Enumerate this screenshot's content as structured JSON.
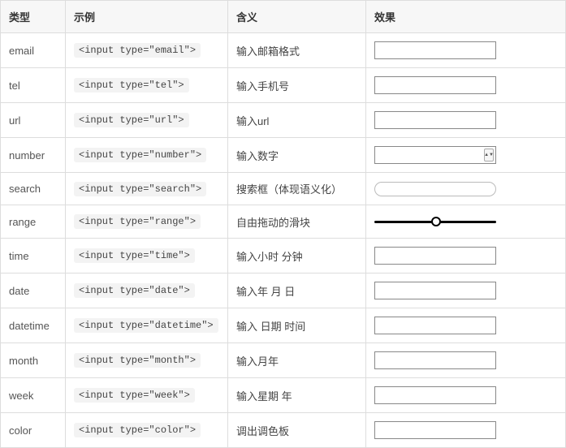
{
  "headers": {
    "type": "类型",
    "example": "示例",
    "meaning": "含义",
    "effect": "效果"
  },
  "rows": [
    {
      "type": "email",
      "example": "<input type=\"email\">",
      "meaning": "输入邮箱格式",
      "effect": "plain"
    },
    {
      "type": "tel",
      "example": "<input type=\"tel\">",
      "meaning": "输入手机号",
      "effect": "plain"
    },
    {
      "type": "url",
      "example": "<input type=\"url\">",
      "meaning": "输入url",
      "effect": "plain"
    },
    {
      "type": "number",
      "example": "<input type=\"number\">",
      "meaning": "输入数字",
      "effect": "number"
    },
    {
      "type": "search",
      "example": "<input type=\"search\">",
      "meaning": "搜索框（体现语义化）",
      "effect": "search"
    },
    {
      "type": "range",
      "example": "<input type=\"range\">",
      "meaning": "自由拖动的滑块",
      "effect": "range"
    },
    {
      "type": "time",
      "example": "<input type=\"time\">",
      "meaning": "输入小时 分钟",
      "effect": "plain"
    },
    {
      "type": "date",
      "example": "<input type=\"date\">",
      "meaning": "输入年 月 日",
      "effect": "plain"
    },
    {
      "type": "datetime",
      "example": "<input type=\"datetime\">",
      "meaning": "输入 日期 时间",
      "effect": "plain"
    },
    {
      "type": "month",
      "example": "<input type=\"month\">",
      "meaning": "输入月年",
      "effect": "plain"
    },
    {
      "type": "week",
      "example": "<input type=\"week\">",
      "meaning": "输入星期 年",
      "effect": "plain"
    },
    {
      "type": "color",
      "example": "<input type=\"color\">",
      "meaning": "调出调色板",
      "effect": "plain"
    }
  ],
  "watermark": ""
}
